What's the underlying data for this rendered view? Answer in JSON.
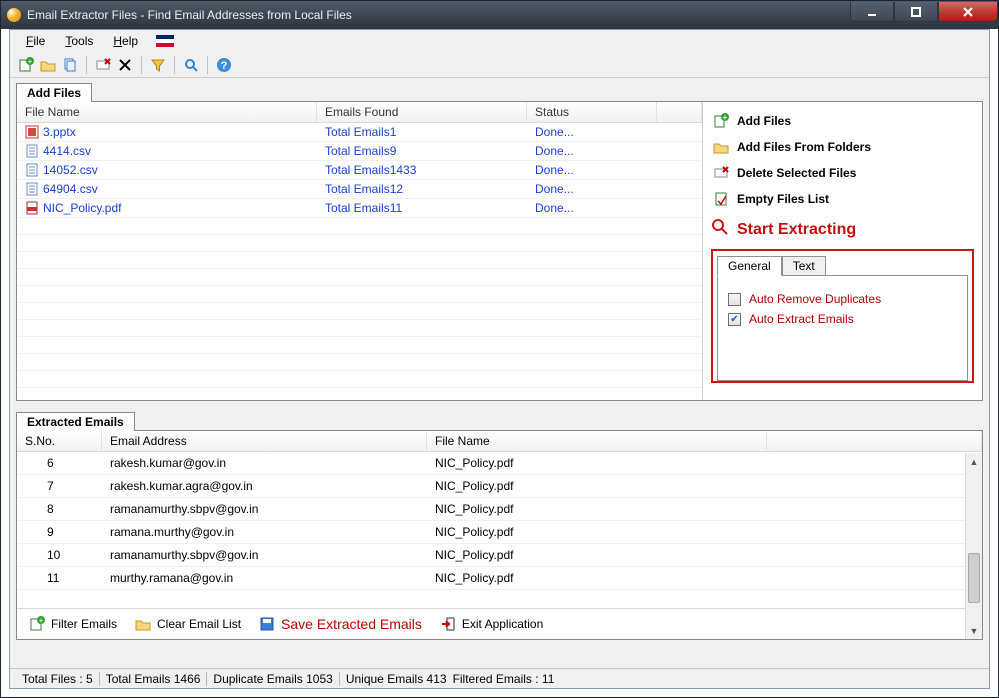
{
  "window_title": "Email Extractor Files -  Find Email Addresses from Local Files",
  "menubar": {
    "file": "File",
    "tools": "Tools",
    "help": "Help"
  },
  "tabs": {
    "add_files": "Add Files",
    "extracted_emails": "Extracted Emails"
  },
  "files_grid": {
    "columns": {
      "name": "File Name",
      "emails": "Emails Found",
      "status": "Status"
    },
    "rows": [
      {
        "name": "3.pptx",
        "emails": "Total Emails1",
        "status": "Done...",
        "type": "ppt"
      },
      {
        "name": "4414.csv",
        "emails": "Total Emails9",
        "status": "Done...",
        "type": "csv"
      },
      {
        "name": "14052.csv",
        "emails": "Total Emails1433",
        "status": "Done...",
        "type": "csv"
      },
      {
        "name": "64904.csv",
        "emails": "Total Emails12",
        "status": "Done...",
        "type": "csv"
      },
      {
        "name": "NIC_Policy.pdf",
        "emails": "Total Emails11",
        "status": "Done...",
        "type": "pdf"
      }
    ]
  },
  "side": {
    "add_files": "Add Files",
    "add_folders": "Add Files From Folders",
    "delete_selected": "Delete Selected Files",
    "empty_list": "Empty Files List",
    "start": "Start Extracting",
    "tabs": {
      "general": "General",
      "text": "Text"
    },
    "opt_dupes": "Auto Remove Duplicates",
    "opt_auto": "Auto Extract Emails"
  },
  "emails_grid": {
    "columns": {
      "sno": "S.No.",
      "email": "Email Address",
      "file": "File Name"
    },
    "rows": [
      {
        "sno": "6",
        "email": "rakesh.kumar@gov.in",
        "file": "NIC_Policy.pdf"
      },
      {
        "sno": "7",
        "email": "rakesh.kumar.agra@gov.in",
        "file": "NIC_Policy.pdf"
      },
      {
        "sno": "8",
        "email": "ramanamurthy.sbpv@gov.in",
        "file": "NIC_Policy.pdf"
      },
      {
        "sno": "9",
        "email": "ramana.murthy@gov.in",
        "file": "NIC_Policy.pdf"
      },
      {
        "sno": "10",
        "email": "ramanamurthy.sbpv@gov.in",
        "file": "NIC_Policy.pdf"
      },
      {
        "sno": "11",
        "email": "murthy.ramana@gov.in",
        "file": "NIC_Policy.pdf"
      }
    ]
  },
  "bottom": {
    "filter": "Filter Emails",
    "clear": "Clear Email List",
    "save": "Save Extracted Emails",
    "exit": "Exit Application"
  },
  "status": {
    "total_files": "Total Files :  5",
    "total_emails": "Total Emails  1466",
    "dup": "Duplicate Emails  1053",
    "uniq": "Unique Emails  413",
    "filt": "Filtered Emails :  11"
  }
}
